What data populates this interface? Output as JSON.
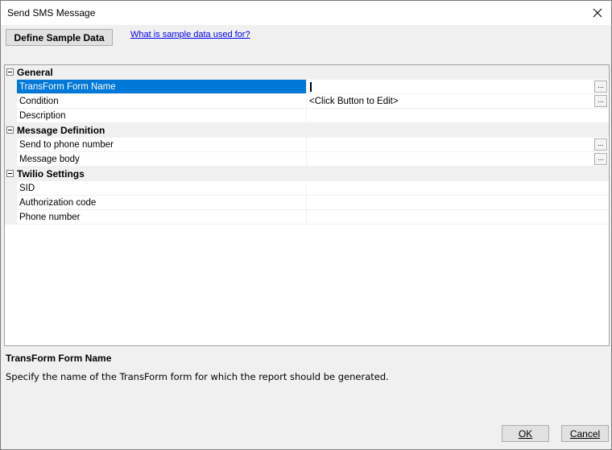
{
  "window": {
    "title": "Send SMS Message"
  },
  "toolbar": {
    "define_label": "Define Sample Data",
    "help_link": "What is sample data used for?"
  },
  "grid": {
    "categories": [
      {
        "label": "General",
        "props": [
          {
            "name": "TransForm Form Name",
            "value": "",
            "has_button": true,
            "selected": true
          },
          {
            "name": "Condition",
            "value": "<Click Button to Edit>",
            "has_button": true
          },
          {
            "name": "Description",
            "value": "",
            "has_button": false
          }
        ]
      },
      {
        "label": "Message Definition",
        "props": [
          {
            "name": "Send to phone number",
            "value": "",
            "has_button": true
          },
          {
            "name": "Message body",
            "value": "",
            "has_button": true
          }
        ]
      },
      {
        "label": "Twilio Settings",
        "props": [
          {
            "name": "SID",
            "value": "",
            "has_button": false
          },
          {
            "name": "Authorization code",
            "value": "",
            "has_button": false
          },
          {
            "name": "Phone number",
            "value": "",
            "has_button": false
          }
        ]
      }
    ],
    "ellipsis_label": "..."
  },
  "description": {
    "title": "TransForm Form Name",
    "text": "Specify the name of the TransForm form for which the report should be generated."
  },
  "buttons": {
    "ok": "OK",
    "cancel": "Cancel"
  }
}
